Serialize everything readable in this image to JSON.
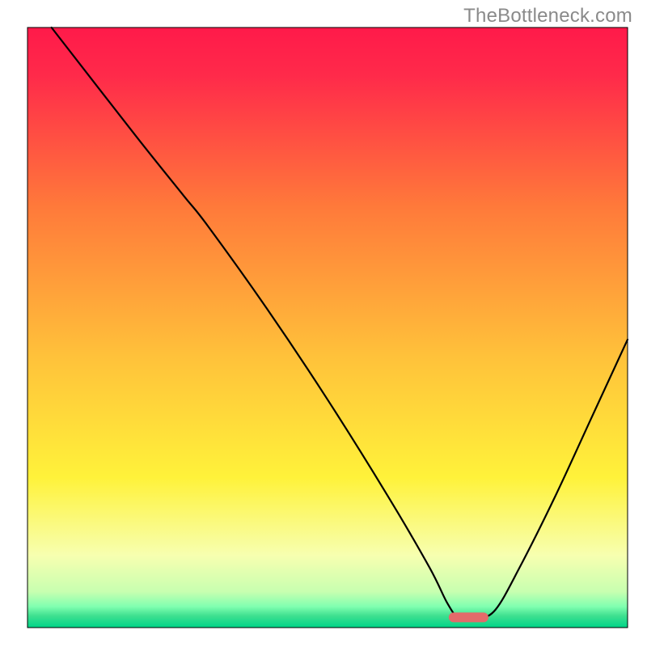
{
  "watermark": "TheBottleneck.com",
  "chart_data": {
    "type": "line",
    "title": "",
    "xlabel": "",
    "ylabel": "",
    "xlim": [
      0,
      100
    ],
    "ylim": [
      0,
      100
    ],
    "grid": false,
    "legend": false,
    "axes_visible": false,
    "description": "Bottleneck curve drawn over a vertical rainbow gradient (red→orange→yellow→green). Curve is high-left, dips to a minimum around x≈72-75, rises again to the right edge. A short red marker segment sits at the minimum.",
    "background_gradient": {
      "stops": [
        {
          "offset": 0.0,
          "color": "#ff1a4a"
        },
        {
          "offset": 0.08,
          "color": "#ff2a4a"
        },
        {
          "offset": 0.3,
          "color": "#ff7a3a"
        },
        {
          "offset": 0.55,
          "color": "#ffc23a"
        },
        {
          "offset": 0.75,
          "color": "#fff23a"
        },
        {
          "offset": 0.88,
          "color": "#f7ffb0"
        },
        {
          "offset": 0.94,
          "color": "#c8ffb0"
        },
        {
          "offset": 0.965,
          "color": "#80ffb0"
        },
        {
          "offset": 0.98,
          "color": "#40e090"
        },
        {
          "offset": 1.0,
          "color": "#00d488"
        }
      ]
    },
    "curve_points": [
      {
        "x": 4,
        "y": 100
      },
      {
        "x": 18,
        "y": 82
      },
      {
        "x": 26,
        "y": 72
      },
      {
        "x": 30,
        "y": 67
      },
      {
        "x": 40,
        "y": 53
      },
      {
        "x": 50,
        "y": 38
      },
      {
        "x": 60,
        "y": 22
      },
      {
        "x": 67,
        "y": 10
      },
      {
        "x": 70,
        "y": 4
      },
      {
        "x": 72,
        "y": 1.5
      },
      {
        "x": 75,
        "y": 1.5
      },
      {
        "x": 78,
        "y": 3
      },
      {
        "x": 82,
        "y": 10
      },
      {
        "x": 88,
        "y": 22
      },
      {
        "x": 94,
        "y": 35
      },
      {
        "x": 100,
        "y": 48
      }
    ],
    "marker": {
      "x_start": 71,
      "x_end": 76,
      "y": 1.7,
      "color": "#e46a6a",
      "thickness": 2.8
    },
    "curve_color": "#000000",
    "curve_width": 2.2
  }
}
